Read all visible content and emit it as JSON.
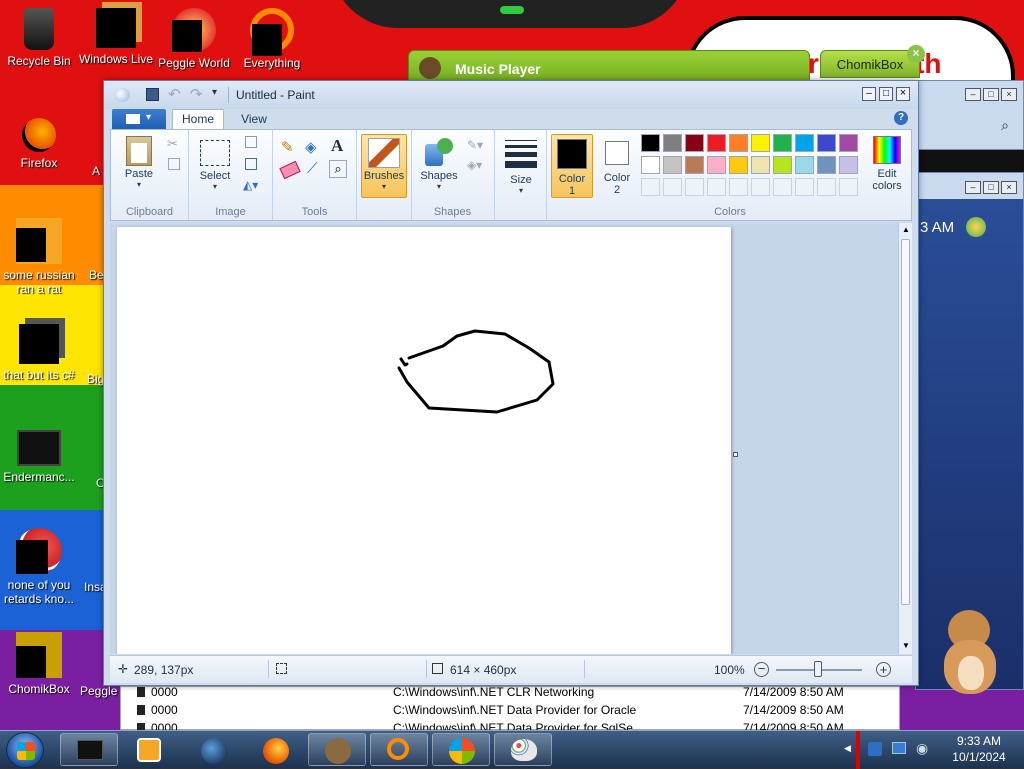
{
  "colors": {
    "accent": "#f5c466",
    "ribbon_tab": "#1e5fb3",
    "red": "#e01010",
    "orange": "#ff8c00",
    "yellow": "#ffe500",
    "green": "#1da01d",
    "blue": "#1a62d6",
    "purple": "#7b1fa2"
  },
  "desktop": {
    "icons": [
      {
        "label": "Recycle Bin",
        "icon": "recycle-bin-icon"
      },
      {
        "label": "Windows Live",
        "icon": "windows-live-icon"
      },
      {
        "label": "Peggle World",
        "icon": "peggle-icon"
      },
      {
        "label": "Everything",
        "icon": "everything-search-icon"
      },
      {
        "label": "Firefox",
        "icon": "firefox-icon"
      },
      {
        "label": "some russian ran a rat",
        "icon": "file-icon"
      },
      {
        "label": "that but its c#",
        "icon": "folder-icon"
      },
      {
        "label": "Endermanc...",
        "icon": "app-icon"
      },
      {
        "label": "none of you retards kno...",
        "icon": "firefox-icon"
      },
      {
        "label": "ChomikBox",
        "icon": "chomikbox-icon"
      },
      {
        "label": "A",
        "icon": "app-icon"
      },
      {
        "label": "Be",
        "icon": "app-icon"
      },
      {
        "label": "Big",
        "icon": "app-icon"
      },
      {
        "label": "C",
        "icon": "app-icon"
      },
      {
        "label": "Insa",
        "icon": "app-icon"
      },
      {
        "label": "Peggle",
        "icon": "peggle-icon"
      }
    ]
  },
  "background_windows": {
    "music_player_title": "Music Player",
    "chomikbox_tab": "ChomikBox",
    "clock_fragment": "3 AM",
    "list": [
      {
        "num": "0000",
        "path": "C:\\Windows\\inf\\.NET CLR Networking",
        "date": "7/14/2009 8:50 AM"
      },
      {
        "num": "0000",
        "path": "C:\\Windows\\inf\\.NET Data Provider for Oracle",
        "date": "7/14/2009 8:50 AM"
      },
      {
        "num": "0000",
        "path": "C:\\Windows\\inf\\.NET Data Provider for SqlSe...",
        "date": "7/14/2009 8:50 AM"
      }
    ]
  },
  "paint": {
    "title": "Untitled - Paint",
    "tabs": [
      "Home",
      "View"
    ],
    "clipboard": {
      "paste": "Paste",
      "group": "Clipboard"
    },
    "image": {
      "select": "Select",
      "group": "Image"
    },
    "tools": {
      "group": "Tools"
    },
    "brushes": {
      "label": "Brushes"
    },
    "shapes": {
      "label": "Shapes",
      "group": "Shapes"
    },
    "size": {
      "label": "Size"
    },
    "color1": {
      "label1": "Color",
      "label2": "1",
      "value": "#000000"
    },
    "color2": {
      "label1": "Color",
      "label2": "2",
      "value": "#ffffff"
    },
    "edit_colors": {
      "label1": "Edit",
      "label2": "colors"
    },
    "colors_group": "Colors",
    "palette_row1": [
      "#000000",
      "#7f7f7f",
      "#880015",
      "#ed1c24",
      "#ff7f27",
      "#fff200",
      "#22b14c",
      "#00a2e8",
      "#3f48cc",
      "#a349a4"
    ],
    "palette_row2": [
      "#ffffff",
      "#c3c3c3",
      "#b97a57",
      "#ffaec9",
      "#ffc90e",
      "#efe4b0",
      "#b5e61d",
      "#99d9ea",
      "#7092be",
      "#c8bfe7"
    ],
    "status": {
      "cursor_pos": "289, 137px",
      "canvas_size": "614 × 460px",
      "zoom": "100%"
    }
  },
  "taskbar": {
    "clock_time": "9:33 AM",
    "clock_date": "10/1/2024",
    "buttons": [
      "start-orb",
      "black-app",
      "media-player",
      "globe",
      "firefox",
      "chomikbox",
      "everything-search",
      "windows-explorer",
      "paint"
    ]
  }
}
